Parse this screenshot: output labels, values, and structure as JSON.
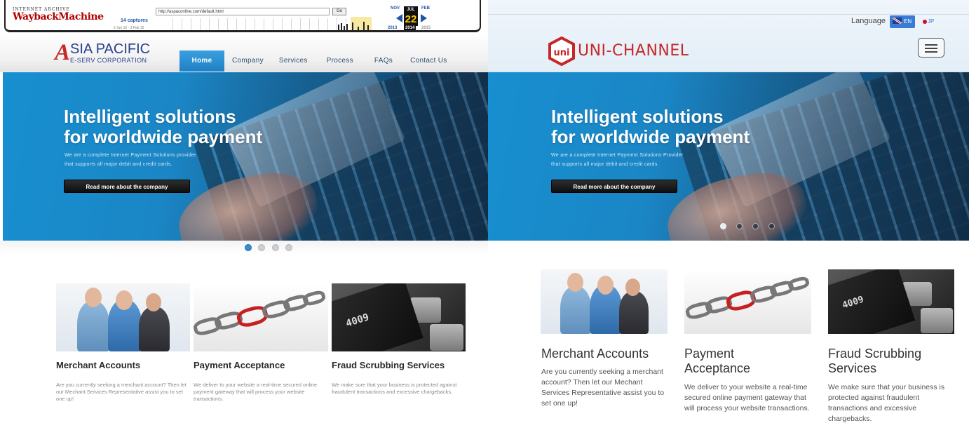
{
  "wayback": {
    "ia_label": "INTERNET ARCHIVE",
    "logo": "WaybackMachine",
    "url": "http://aspaconline.com/default.html",
    "go": "Go",
    "captures": "14 captures",
    "range": "2 Jun 12 - 3 Feb 15",
    "month_prev": "NOV",
    "month_cur": "JUL",
    "month_next": "FEB",
    "day": "22",
    "year_prev": "2013",
    "year_cur": "2014",
    "year_next": "2015"
  },
  "left": {
    "logo_a": "A",
    "logo_sia": "SIA PACIFIC",
    "logo_sub": "E-SERV CORPORATION",
    "nav": [
      "Home",
      "Company",
      "Services",
      "Process",
      "FAQs",
      "Contact Us"
    ],
    "hero": {
      "title_1": "Intelligent solutions",
      "title_2": "for worldwide payment",
      "sub_1": "We are a complete Internet Payment Solutions provider",
      "sub_2": "that supports all major debit and credit cards.",
      "button": "Read more about the company"
    },
    "features": [
      {
        "title": "Merchant Accounts",
        "text": "Are you currently seeking a merchant account? Then let our Mechant Services Representative assist you to set one up!"
      },
      {
        "title": "Payment Acceptance",
        "text": "We deliver to your website a real-time secured online payment gateway that will process your website transactions."
      },
      {
        "title": "Fraud Scrubbing Services",
        "text": "We make sure that your business is protected against fraudulent transactions and excessive chargebacks."
      }
    ]
  },
  "right": {
    "language_label": "Language",
    "lang_en": "EN",
    "lang_jp": "JP",
    "logo_mark": "uni",
    "logo_text": "UNI-CHANNEL",
    "hero": {
      "title_1": "Intelligent solutions",
      "title_2": "for worldwide payment",
      "sub_1": "We are a complete Internet Payment Solutions Provider",
      "sub_2": "that supports all major debit and credit cards.",
      "button": "Read more about the company"
    },
    "features": [
      {
        "title_1": "Merchant Accounts",
        "title_2": "",
        "text": "Are you currently seeking a merchant account? Then let our Mechant Services Representative assist you to set one up!"
      },
      {
        "title_1": "Payment",
        "title_2": "Acceptance",
        "text": "We deliver to your website a real-time secured online payment gateway that will process your website transactions."
      },
      {
        "title_1": "Fraud Scrubbing",
        "title_2": "Services",
        "text": "We make sure that your business is protected against fraudulent transactions and excessive chargebacks."
      }
    ]
  },
  "card_number": "4009",
  "colors": {
    "accent_blue": "#1f7fc4",
    "brand_red": "#c62828",
    "logo_navy": "#27408b"
  }
}
